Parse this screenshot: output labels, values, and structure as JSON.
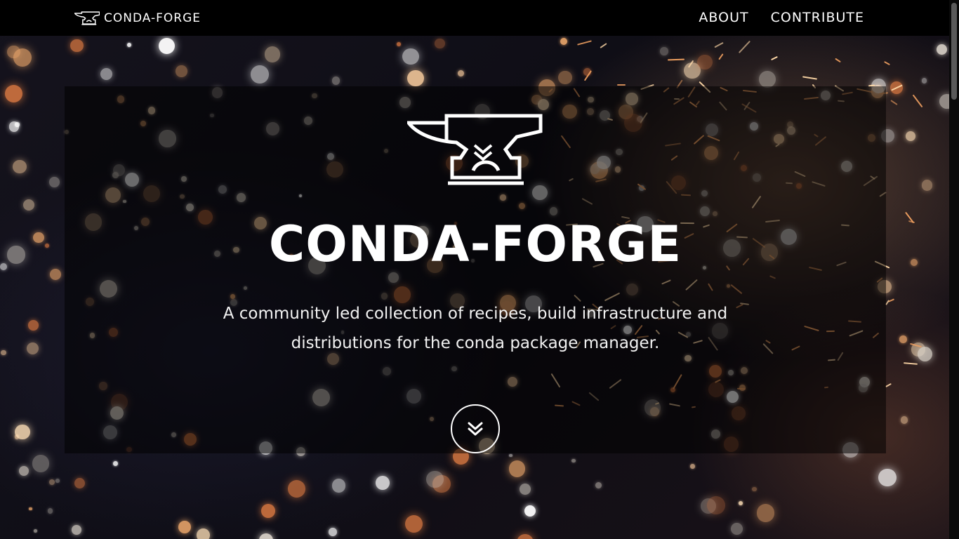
{
  "navbar": {
    "brand": {
      "icon": "anvil-icon",
      "label": "CONDA-FORGE"
    },
    "links": [
      {
        "label": "ABOUT"
      },
      {
        "label": "CONTRIBUTE"
      }
    ]
  },
  "hero": {
    "logo_icon": "anvil-icon",
    "title": "CONDA-FORGE",
    "subtitle": "A community led collection of recipes, build infrastructure and distributions for the conda package manager.",
    "scroll_button_icon": "double-chevron-down-icon"
  },
  "colors": {
    "navbar_bg": "#000000",
    "text": "#ffffff",
    "hero_overlay": "rgba(0,0,0,0.52)"
  }
}
